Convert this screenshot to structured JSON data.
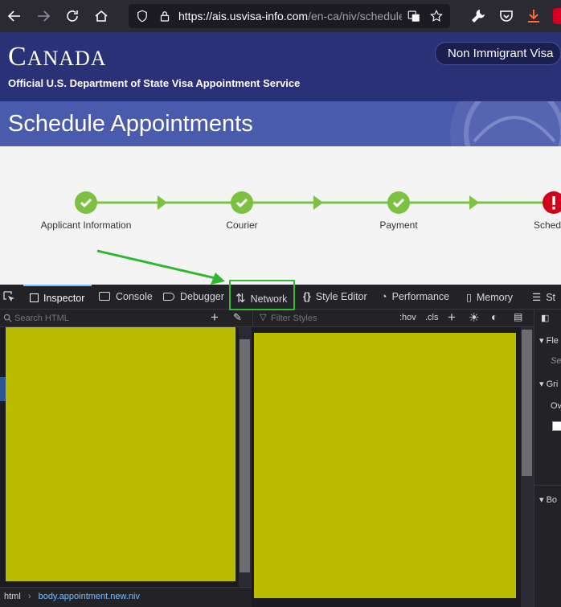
{
  "browser": {
    "url_host": "https://ais.usvisa-info.com",
    "url_path": "/en-ca/niv/schedule"
  },
  "header": {
    "country_initial": "C",
    "country_rest": "ANADA",
    "subtitle": "Official U.S. Department of State Visa Appointment Service",
    "visa_type": "Non Immigrant Visa"
  },
  "section": {
    "title": "Schedule Appointments"
  },
  "progress": {
    "steps": [
      {
        "label": "Applicant Information",
        "status": "complete"
      },
      {
        "label": "Courier",
        "status": "complete"
      },
      {
        "label": "Payment",
        "status": "complete"
      },
      {
        "label": "Sched",
        "status": "error"
      }
    ],
    "complete_color": "#7dc142",
    "error_color": "#d0021b"
  },
  "devtools": {
    "tabs": [
      "Inspector",
      "Console",
      "Debugger",
      "Network",
      "Style Editor",
      "Performance",
      "Memory",
      "St"
    ],
    "active_tab": "Inspector",
    "highlighted_tab": "Network",
    "search_placeholder": "Search HTML",
    "filter_placeholder": "Filter Styles",
    "hov_label": ":hov",
    "cls_label": ".cls",
    "breadcrumb_root": "html",
    "breadcrumb_selected": "body.appointment.new.niv",
    "right_panel": [
      "Fle",
      "Se",
      "Gri",
      "Ov",
      "Bo"
    ]
  },
  "colors": {
    "header_bg": "#2b3177",
    "band_bg": "#4a5aad",
    "annotation_green": "#3bb53b",
    "redaction_yellow": "#bbbb00"
  }
}
